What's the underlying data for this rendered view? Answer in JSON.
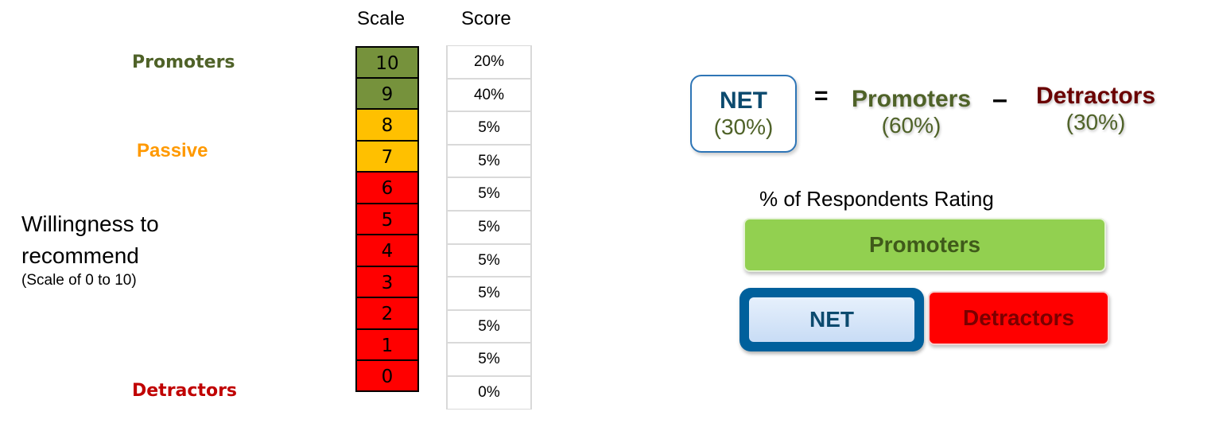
{
  "categories": {
    "promoters": "Promoters",
    "passive": "Passive",
    "detractors": "Detractors"
  },
  "axis_label": {
    "line1": "Willingness to",
    "line2": "recommend",
    "line3": "(Scale of 0 to 10)"
  },
  "table": {
    "scale_header": "Scale",
    "score_header": "Score",
    "rows": [
      {
        "scale": "10",
        "score": "20%",
        "group": "promoter"
      },
      {
        "scale": "9",
        "score": "40%",
        "group": "promoter"
      },
      {
        "scale": "8",
        "score": "5%",
        "group": "passive"
      },
      {
        "scale": "7",
        "score": "5%",
        "group": "passive"
      },
      {
        "scale": "6",
        "score": "5%",
        "group": "detractor"
      },
      {
        "scale": "5",
        "score": "5%",
        "group": "detractor"
      },
      {
        "scale": "4",
        "score": "5%",
        "group": "detractor"
      },
      {
        "scale": "3",
        "score": "5%",
        "group": "detractor"
      },
      {
        "scale": "2",
        "score": "5%",
        "group": "detractor"
      },
      {
        "scale": "1",
        "score": "5%",
        "group": "detractor"
      },
      {
        "scale": "0",
        "score": "0%",
        "group": "detractor"
      }
    ]
  },
  "colors": {
    "promoter": "#76923c",
    "passive": "#ffc000",
    "detractor": "#ff0000"
  },
  "equation": {
    "net_label": "NET",
    "net_value": "(30%)",
    "equals": "=",
    "promoters_label": "Promoters",
    "promoters_value": "(60%)",
    "minus": "–",
    "detractors_label": "Detractors",
    "detractors_value": "(30%)"
  },
  "respondents": {
    "title": "% of Respondents Rating",
    "promoters_bar": "Promoters",
    "net_bar": "NET",
    "detractors_bar": "Detractors"
  }
}
